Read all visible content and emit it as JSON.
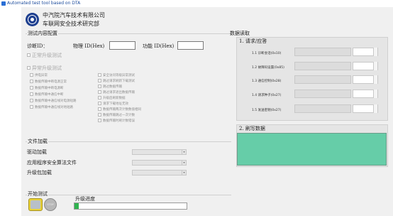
{
  "window": {
    "title": "Automated test tool based on DTA"
  },
  "header": {
    "company": "中汽院汽车技术有限公司",
    "sub_company": "车联网安全技术研究部"
  },
  "test_config": {
    "title": "测试内容配置",
    "diag_id_label": "诊断ID：",
    "physical_id_label": "物理 ID(Hex)",
    "physical_id_value": "",
    "functional_id_label": "功能 ID(Hex)",
    "functional_id_value": "",
    "normal_upgrade_label": "正常升级测试",
    "abnormal_upgrade_label": "异常升级测试",
    "left_options": [
      "供电异常",
      "数据传输中断电源正常",
      "数据传输中断电源断",
      "数据传输中通信中断",
      "数据传输中通信线对电源短路",
      "数据传输中通信线对地短路"
    ],
    "right_options": [
      "安全访问等级异常测试",
      "跳过请求刷新下载测试",
      "跳过数据传输",
      "跳过请求退出数据传输",
      "升级后刷新数据",
      "请求下载地址无效",
      "数据传输两次计数数值相同",
      "数据传输跳过一次计数",
      "数据传输时刷计数错误"
    ]
  },
  "file_load": {
    "title": "文件加载",
    "driver_label": "驱动加载",
    "algorithm_label": "应用程序安全算法文件",
    "package_label": "升级包加载"
  },
  "start_test": {
    "title": "开始测试",
    "stop_label": "STOP",
    "progress_label": "升级进度",
    "progress_value": 0.04
  },
  "data_read": {
    "title": "数据读取",
    "request_title": "1. 请求/应答",
    "requests": [
      "1.1 诊断会话(0x10)",
      "1.2 故障码设置(0x85)",
      "1.3 通信控制(0x28)",
      "1.4 请求种子(0x27)",
      "1.5 发送密钥(0x27)"
    ],
    "response_title": "2. 刷写数据"
  },
  "colors": {
    "response_area": "#66cda8",
    "progress_fill": "#2fb34f"
  }
}
